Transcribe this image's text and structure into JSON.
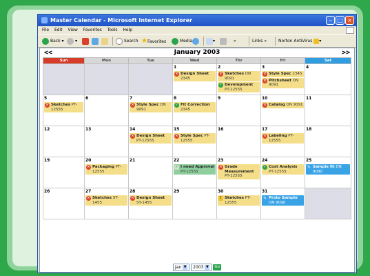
{
  "window": {
    "title": "Master Calendar - Microsoft Internet Explorer"
  },
  "menu": [
    "File",
    "Edit",
    "View",
    "Favorites",
    "Tools",
    "Help"
  ],
  "toolbar": {
    "back": "Back",
    "search": "Search",
    "favorites": "Favorites",
    "media": "Media",
    "links": "Links",
    "antivirus": "Norton AntiVirus"
  },
  "calendar": {
    "prev": "<<",
    "next": ">>",
    "month_title": "January 2003",
    "weekdays": [
      "Sun",
      "Mon",
      "Tue",
      "Wed",
      "Thr",
      "Fri",
      "Sat"
    ],
    "weeks": [
      [
        {
          "day": "",
          "events": []
        },
        {
          "day": "",
          "events": []
        },
        {
          "day": "",
          "events": []
        },
        {
          "day": "1",
          "events": [
            {
              "title": "Design Sheet",
              "sub": "2345",
              "color": "y",
              "icon": "red"
            }
          ]
        },
        {
          "day": "2",
          "events": [
            {
              "title": "Sketches",
              "sub": "DN 9091",
              "color": "y",
              "icon": "red"
            },
            {
              "title": "Development",
              "sub": "PT-12555",
              "color": "y",
              "icon": "green"
            }
          ]
        },
        {
          "day": "3",
          "events": [
            {
              "title": "Style Spec",
              "sub": "2345",
              "color": "y",
              "icon": "red"
            },
            {
              "title": "Pitchsheet",
              "sub": "DN 9091",
              "color": "y",
              "icon": "red"
            }
          ]
        },
        {
          "day": "4",
          "events": []
        }
      ],
      [
        {
          "day": "5",
          "events": [
            {
              "title": "Sketches",
              "sub": "PT-12555",
              "color": "y",
              "icon": "red"
            }
          ]
        },
        {
          "day": "6",
          "events": []
        },
        {
          "day": "7",
          "events": [
            {
              "title": "Style Spec",
              "sub": "DN 9091",
              "color": "y",
              "icon": "red"
            }
          ]
        },
        {
          "day": "8",
          "events": [
            {
              "title": "Fit Correction",
              "sub": "2345",
              "color": "y",
              "icon": "green"
            }
          ]
        },
        {
          "day": "9",
          "events": []
        },
        {
          "day": "10",
          "events": [
            {
              "title": "Catalog",
              "sub": "DN 9091",
              "color": "y",
              "icon": "red"
            }
          ]
        },
        {
          "day": "11",
          "events": []
        }
      ],
      [
        {
          "day": "12",
          "events": []
        },
        {
          "day": "13",
          "events": []
        },
        {
          "day": "14",
          "events": [
            {
              "title": "Design Sheet",
              "sub": "PT-12555",
              "color": "y",
              "icon": "red"
            }
          ]
        },
        {
          "day": "15",
          "events": [
            {
              "title": "Style Spec",
              "sub": "PT-12555",
              "color": "y",
              "icon": "red"
            }
          ]
        },
        {
          "day": "16",
          "events": []
        },
        {
          "day": "17",
          "events": [
            {
              "title": "Labeling",
              "sub": "PT-12555",
              "color": "y",
              "icon": "red"
            }
          ]
        },
        {
          "day": "18",
          "events": []
        }
      ],
      [
        {
          "day": "19",
          "events": []
        },
        {
          "day": "20",
          "events": [
            {
              "title": "Packaging",
              "sub": "PT-12555",
              "color": "y",
              "icon": "red"
            }
          ]
        },
        {
          "day": "21",
          "events": []
        },
        {
          "day": "22",
          "events": [
            {
              "title": "I need Approval",
              "sub": "PT-12555",
              "color": "g",
              "icon": "chk"
            }
          ]
        },
        {
          "day": "23",
          "events": [
            {
              "title": "Grade Measurement",
              "sub": "PT-12555",
              "color": "y",
              "icon": "red"
            }
          ]
        },
        {
          "day": "24",
          "events": [
            {
              "title": "Cost Analysis",
              "sub": "PT-12555",
              "color": "y",
              "icon": "green"
            }
          ]
        },
        {
          "day": "25",
          "events": [
            {
              "title": "Sample fit",
              "sub": "DN 9090",
              "color": "b",
              "icon": "pen"
            }
          ]
        }
      ],
      [
        {
          "day": "26",
          "events": []
        },
        {
          "day": "27",
          "events": [
            {
              "title": "Sketches",
              "sub": "ST-1455",
              "color": "y",
              "icon": "red"
            }
          ]
        },
        {
          "day": "28",
          "events": [
            {
              "title": "Design Sheet",
              "sub": "ST-1455",
              "color": "y",
              "icon": "red"
            }
          ]
        },
        {
          "day": "29",
          "events": []
        },
        {
          "day": "30",
          "events": [
            {
              "title": "Sketches",
              "sub": "PT-12555",
              "color": "y",
              "icon": "warn"
            }
          ]
        },
        {
          "day": "31",
          "events": [
            {
              "title": "Proto Sample",
              "sub": "DN 9090",
              "color": "b",
              "icon": "pen"
            }
          ]
        },
        {
          "day": "",
          "events": []
        }
      ]
    ]
  },
  "footer": {
    "month_select": "Jan",
    "year_select": "2003",
    "go": "Go"
  }
}
